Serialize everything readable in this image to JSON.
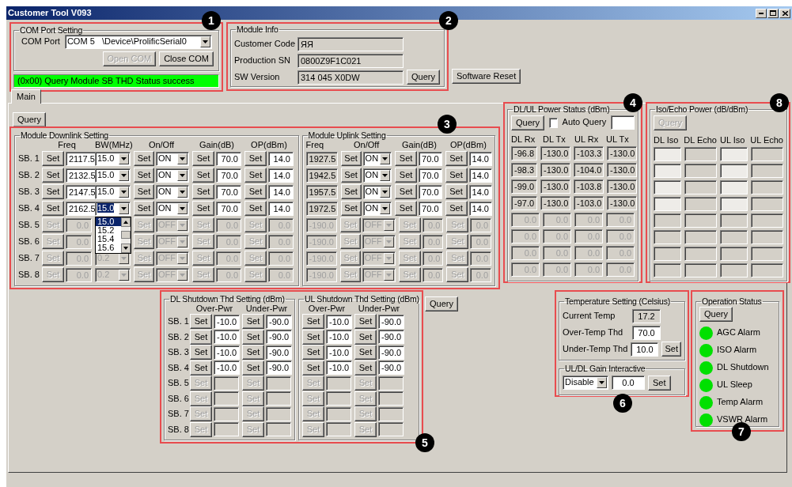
{
  "window": {
    "title": "Customer Tool V093"
  },
  "com_port": {
    "marker": "1",
    "title": "COM Port Setting",
    "label": "COM Port",
    "value": "COM 5   \\Device\\ProlificSerial0",
    "buttons": [
      {
        "label": "Open COM",
        "disabled": true
      },
      {
        "label": "Close COM",
        "disabled": false
      }
    ],
    "status": "(0x00) Query Module SB THD Status success"
  },
  "module_info": {
    "marker": "2",
    "title": "Module Info",
    "fields": [
      {
        "label": "Customer Code",
        "value": "ЯЯ"
      },
      {
        "label": "Production SN",
        "value": "0800Z9F1C021"
      },
      {
        "label": "SW Version",
        "value": "314 045 X0DW"
      }
    ],
    "query": "Query"
  },
  "software_reset": "Software Reset",
  "tabs": [
    {
      "label": "Main",
      "selected": true
    }
  ],
  "main_query": "Query",
  "module_setting": {
    "marker": "3",
    "downlink": {
      "title": "Module Downlink Setting",
      "columns": [
        "Freq",
        "BW(MHz)",
        "On/Off",
        "Gain(dB)",
        "OP(dBm)"
      ],
      "bw_dropdown": {
        "options": [
          {
            "label": "15.0",
            "selected": true
          },
          {
            "label": "15.2",
            "selected": false
          },
          {
            "label": "15.4",
            "selected": false
          },
          {
            "label": "15.6",
            "selected": false
          }
        ]
      },
      "rows": [
        {
          "label": "SB. 1",
          "enabled": true,
          "freq": {
            "button": "Set",
            "value": "2117.5"
          },
          "bw": {
            "value": "15.0",
            "focused": false
          },
          "onoff": {
            "button": "Set",
            "value": "ON"
          },
          "gain": {
            "button": "Set",
            "value": "70.0"
          },
          "op": {
            "button": "Set",
            "value": "14.0"
          }
        },
        {
          "label": "SB. 2",
          "enabled": true,
          "freq": {
            "button": "Set",
            "value": "2132.5"
          },
          "bw": {
            "value": "15.0",
            "focused": false
          },
          "onoff": {
            "button": "Set",
            "value": "ON"
          },
          "gain": {
            "button": "Set",
            "value": "70.0"
          },
          "op": {
            "button": "Set",
            "value": "14.0"
          }
        },
        {
          "label": "SB. 3",
          "enabled": true,
          "freq": {
            "button": "Set",
            "value": "2147.5"
          },
          "bw": {
            "value": "15.0",
            "focused": false
          },
          "onoff": {
            "button": "Set",
            "value": "ON"
          },
          "gain": {
            "button": "Set",
            "value": "70.0"
          },
          "op": {
            "button": "Set",
            "value": "14.0"
          }
        },
        {
          "label": "SB. 4",
          "enabled": true,
          "freq": {
            "button": "Set",
            "value": "2162.5"
          },
          "bw": {
            "value": "15.0",
            "focused": true
          },
          "onoff": {
            "button": "Set",
            "value": "ON"
          },
          "gain": {
            "button": "Set",
            "value": "70.0"
          },
          "op": {
            "button": "Set",
            "value": "14.0"
          }
        },
        {
          "label": "SB. 5",
          "enabled": false,
          "freq": {
            "button": "Set",
            "value": "0.0"
          },
          "onoff": {
            "button": "Set",
            "value": "OFF"
          },
          "gain": {
            "button": "Set",
            "value": "0.0"
          },
          "op": {
            "button": "Set",
            "value": "0.0"
          }
        },
        {
          "label": "SB. 6",
          "enabled": false,
          "freq": {
            "button": "Set",
            "value": "0.0"
          },
          "onoff": {
            "button": "Set",
            "value": "OFF"
          },
          "gain": {
            "button": "Set",
            "value": "0.0"
          },
          "op": {
            "button": "Set",
            "value": "0.0"
          }
        },
        {
          "label": "SB. 7",
          "enabled": false,
          "freq": {
            "button": "Set",
            "value": "0.0"
          },
          "bw": {
            "value": "0.2",
            "focused": false
          },
          "onoff": {
            "button": "Set",
            "value": "OFF"
          },
          "gain": {
            "button": "Set",
            "value": "0.0"
          },
          "op": {
            "button": "Set",
            "value": "0.0"
          }
        },
        {
          "label": "SB. 8",
          "enabled": false,
          "freq": {
            "button": "Set",
            "value": "0.0"
          },
          "bw": {
            "value": "0.2",
            "focused": false
          },
          "onoff": {
            "button": "Set",
            "value": "OFF"
          },
          "gain": {
            "button": "Set",
            "value": "0.0"
          },
          "op": {
            "button": "Set",
            "value": "0.0"
          }
        }
      ]
    },
    "uplink": {
      "title": "Module Uplink Setting",
      "columns": [
        "Freq",
        "On/Off",
        "Gain(dB)",
        "OP(dBm)"
      ],
      "rows": [
        {
          "enabled": true,
          "freq": "1927.5",
          "onoff": {
            "button": "Set",
            "value": "ON"
          },
          "gain": {
            "button": "Set",
            "value": "70.0"
          },
          "op": {
            "button": "Set",
            "value": "14.0"
          }
        },
        {
          "enabled": true,
          "freq": "1942.5",
          "onoff": {
            "button": "Set",
            "value": "ON"
          },
          "gain": {
            "button": "Set",
            "value": "70.0"
          },
          "op": {
            "button": "Set",
            "value": "14.0"
          }
        },
        {
          "enabled": true,
          "freq": "1957.5",
          "onoff": {
            "button": "Set",
            "value": "ON"
          },
          "gain": {
            "button": "Set",
            "value": "70.0"
          },
          "op": {
            "button": "Set",
            "value": "14.0"
          }
        },
        {
          "enabled": true,
          "freq": "1972.5",
          "onoff": {
            "button": "Set",
            "value": "ON"
          },
          "gain": {
            "button": "Set",
            "value": "70.0"
          },
          "op": {
            "button": "Set",
            "value": "14.0"
          }
        },
        {
          "enabled": false,
          "freq": "-190.0",
          "onoff": {
            "button": "Set",
            "value": "OFF"
          },
          "gain": {
            "button": "Set",
            "value": "0.0"
          },
          "op": {
            "button": "Set",
            "value": "0.0"
          }
        },
        {
          "enabled": false,
          "freq": "-190.0",
          "onoff": {
            "button": "Set",
            "value": "OFF"
          },
          "gain": {
            "button": "Set",
            "value": "0.0"
          },
          "op": {
            "button": "Set",
            "value": "0.0"
          }
        },
        {
          "enabled": false,
          "freq": "-190.0",
          "onoff": {
            "button": "Set",
            "value": "OFF"
          },
          "gain": {
            "button": "Set",
            "value": "0.0"
          },
          "op": {
            "button": "Set",
            "value": "0.0"
          }
        },
        {
          "enabled": false,
          "freq": "-190.0",
          "onoff": {
            "button": "Set",
            "value": "OFF"
          },
          "gain": {
            "button": "Set",
            "value": "0.0"
          },
          "op": {
            "button": "Set",
            "value": "0.0"
          }
        }
      ]
    }
  },
  "power_status": {
    "marker": "4",
    "title": "DL/UL Power Status (dBm)",
    "query": "Query",
    "auto_query": {
      "label": "Auto Query",
      "checked": false
    },
    "columns": [
      "DL Rx",
      "DL Tx",
      "UL Rx",
      "UL Tx"
    ],
    "rows": [
      {
        "enabled": true,
        "values": [
          "-96.8",
          "-130.0",
          "-103.3",
          "-130.0"
        ]
      },
      {
        "enabled": true,
        "values": [
          "-98.3",
          "-130.0",
          "-104.0",
          "-130.0"
        ]
      },
      {
        "enabled": true,
        "values": [
          "-99.0",
          "-130.0",
          "-103.8",
          "-130.0"
        ]
      },
      {
        "enabled": true,
        "values": [
          "-97.0",
          "-130.0",
          "-103.0",
          "-130.0"
        ]
      },
      {
        "enabled": false,
        "values": [
          "0.0",
          "0.0",
          "0.0",
          "0.0"
        ]
      },
      {
        "enabled": false,
        "values": [
          "0.0",
          "0.0",
          "0.0",
          "0.0"
        ]
      },
      {
        "enabled": false,
        "values": [
          "0.0",
          "0.0",
          "0.0",
          "0.0"
        ]
      },
      {
        "enabled": false,
        "values": [
          "0.0",
          "0.0",
          "0.0",
          "0.0"
        ]
      }
    ]
  },
  "iso_echo": {
    "marker": "8",
    "title": "Iso/Echo Power (dB/dBm)",
    "query": {
      "label": "Query",
      "disabled": true
    },
    "columns": [
      "DL Iso",
      "DL Echo",
      "UL Iso",
      "UL Echo"
    ],
    "rows": [
      {
        "enabled": true
      },
      {
        "enabled": true
      },
      {
        "enabled": true
      },
      {
        "enabled": true
      },
      {
        "enabled": false
      },
      {
        "enabled": false
      },
      {
        "enabled": false
      },
      {
        "enabled": false
      }
    ]
  },
  "shutdown": {
    "marker": "5",
    "groups": [
      {
        "title": "DL Shutdown Thd Setting (dBm)",
        "columns": [
          "Over-Pwr",
          "Under-Pwr"
        ],
        "rows": [
          {
            "label": "SB. 1",
            "enabled": true,
            "cells": [
              {
                "button": "Set",
                "value": "-10.0"
              },
              {
                "button": "Set",
                "value": "-90.0"
              }
            ]
          },
          {
            "label": "SB. 2",
            "enabled": true,
            "cells": [
              {
                "button": "Set",
                "value": "-10.0"
              },
              {
                "button": "Set",
                "value": "-90.0"
              }
            ]
          },
          {
            "label": "SB. 3",
            "enabled": true,
            "cells": [
              {
                "button": "Set",
                "value": "-10.0"
              },
              {
                "button": "Set",
                "value": "-90.0"
              }
            ]
          },
          {
            "label": "SB. 4",
            "enabled": true,
            "cells": [
              {
                "button": "Set",
                "value": "-10.0"
              },
              {
                "button": "Set",
                "value": "-90.0"
              }
            ]
          },
          {
            "label": "SB. 5",
            "enabled": false,
            "cells": [
              {
                "button": "Set"
              },
              {
                "button": "Set"
              }
            ]
          },
          {
            "label": "SB. 6",
            "enabled": false,
            "cells": [
              {
                "button": "Set"
              },
              {
                "button": "Set"
              }
            ]
          },
          {
            "label": "SB. 7",
            "enabled": false,
            "cells": [
              {
                "button": "Set"
              },
              {
                "button": "Set"
              }
            ]
          },
          {
            "label": "SB. 8",
            "enabled": false,
            "cells": [
              {
                "button": "Set"
              },
              {
                "button": "Set"
              }
            ]
          }
        ]
      },
      {
        "title": "UL Shutdown Thd Setting (dBm)",
        "columns": [
          "Over-Pwr",
          "Under-Pwr"
        ],
        "rows": [
          {
            "enabled": true,
            "cells": [
              {
                "button": "Set",
                "value": "-10.0"
              },
              {
                "button": "Set",
                "value": "-90.0"
              }
            ]
          },
          {
            "enabled": true,
            "cells": [
              {
                "button": "Set",
                "value": "-10.0"
              },
              {
                "button": "Set",
                "value": "-90.0"
              }
            ]
          },
          {
            "enabled": true,
            "cells": [
              {
                "button": "Set",
                "value": "-10.0"
              },
              {
                "button": "Set",
                "value": "-90.0"
              }
            ]
          },
          {
            "enabled": true,
            "cells": [
              {
                "button": "Set",
                "value": "-10.0"
              },
              {
                "button": "Set",
                "value": "-90.0"
              }
            ]
          },
          {
            "enabled": false,
            "cells": [
              {
                "button": "Set"
              },
              {
                "button": "Set"
              }
            ]
          },
          {
            "enabled": false,
            "cells": [
              {
                "button": "Set"
              },
              {
                "button": "Set"
              }
            ]
          },
          {
            "enabled": false,
            "cells": [
              {
                "button": "Set"
              },
              {
                "button": "Set"
              }
            ]
          },
          {
            "enabled": false,
            "cells": [
              {
                "button": "Set"
              },
              {
                "button": "Set"
              }
            ]
          }
        ]
      }
    ]
  },
  "shutdown_query": "Query",
  "temperature": {
    "marker": "6",
    "title": "Temperature Setting (Celsius)",
    "fields": [
      {
        "label": "Current Temp",
        "value": "17.2",
        "kind": "readout"
      },
      {
        "label": "Over-Temp Thd",
        "value": "70.0",
        "kind": "input"
      },
      {
        "label": "Under-Temp Thd",
        "value": "10.0",
        "kind": "input"
      }
    ],
    "set": "Set",
    "gain_interactive": {
      "title": "UL/DL Gain Interactive",
      "mode": "Disable",
      "value": "0.0",
      "set": "Set"
    }
  },
  "operation_status": {
    "marker": "7",
    "title": "Operation Status",
    "query": "Query",
    "alarms": [
      {
        "label": "AGC Alarm",
        "alarm": false
      },
      {
        "label": "ISO Alarm",
        "alarm": false
      },
      {
        "label": "DL Shutdown",
        "alarm": false
      },
      {
        "label": "UL Sleep",
        "alarm": false
      },
      {
        "label": "Temp Alarm",
        "alarm": false
      },
      {
        "label": "VSWR Alarm",
        "alarm": false
      }
    ]
  }
}
